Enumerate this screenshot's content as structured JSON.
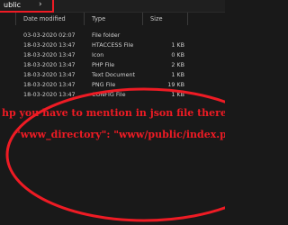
{
  "address_bar": {
    "path_tail": "ublic",
    "chevron": "›"
  },
  "columns": {
    "date": "Date modified",
    "type": "Type",
    "size": "Size"
  },
  "rows": [
    {
      "date": "03-03-2020 02:07",
      "type": "File folder",
      "size": ""
    },
    {
      "date": "18-03-2020 13:47",
      "type": "HTACCESS File",
      "size": "1 KB"
    },
    {
      "date": "18-03-2020 13:47",
      "type": "Icon",
      "size": "0 KB"
    },
    {
      "date": "18-03-2020 13:47",
      "type": "PHP File",
      "size": "2 KB"
    },
    {
      "date": "18-03-2020 13:47",
      "type": "Text Document",
      "size": "1 KB"
    },
    {
      "date": "18-03-2020 13:47",
      "type": "PNG File",
      "size": "19 KB"
    },
    {
      "date": "18-03-2020 13:47",
      "type": "CONFIG File",
      "size": "1 KB"
    }
  ],
  "annotation": {
    "line1": "hp you have to mention in json file there line",
    "line2": "\"www_directory\": \"www/public/index.php\",)",
    "color": "#ee1b24"
  },
  "colors": {
    "background": "#191919",
    "text": "#cfcfcf",
    "highlight": "#ee1b24"
  }
}
